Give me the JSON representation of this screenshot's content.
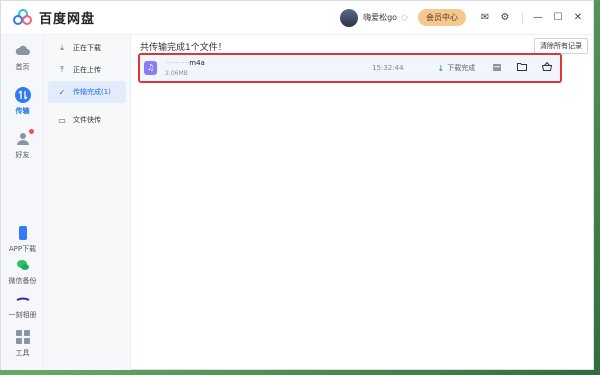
{
  "app": {
    "name": "百度网盘"
  },
  "header": {
    "username": "嗨爱松go",
    "vip_label": "会员中心"
  },
  "rail": {
    "home": "首页",
    "transfer": "传输",
    "friends": "好友",
    "app_download": "APP下载",
    "wechat_backup": "微信备份",
    "moments": "一刻相册",
    "tools": "工具"
  },
  "subnav": {
    "downloading": "正在下载",
    "uploading": "正在上传",
    "completed": "传输完成(1)",
    "fast_transfer": "文件快传"
  },
  "main": {
    "title": "共传输完成1个文件！",
    "clear_label": "清除所有记录"
  },
  "file": {
    "name_hidden": "···· ··· ·····",
    "name_ext": "m4a",
    "size": "2.06MB",
    "time": "15:32:44",
    "status": "下载完成"
  },
  "colors": {
    "accent": "#1f6fe6",
    "highlight": "#e1333a",
    "vip": "#f6c890"
  }
}
